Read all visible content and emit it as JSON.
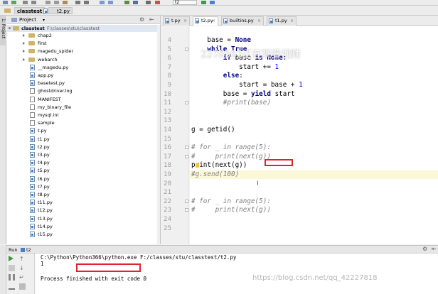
{
  "toolbar": {
    "config_select": "t2",
    "icons": [
      "save-icon",
      "sync-icon",
      "undo-icon",
      "redo-icon",
      "cut-icon",
      "copy-icon",
      "paste-icon",
      "find-icon",
      "replace-icon",
      "back-icon",
      "forward-icon",
      "run-icon",
      "debug-icon",
      "stop-icon"
    ]
  },
  "breadcrumb": {
    "items": [
      "classtest",
      "t2.py"
    ]
  },
  "side_strip": {
    "project_tab": "1: Project"
  },
  "project_panel": {
    "title": "Project",
    "root_name": "classtest",
    "root_path": "F:\\classes\\stu\\classtest",
    "items": [
      {
        "label": "chap2",
        "type": "folder"
      },
      {
        "label": "first",
        "type": "folder"
      },
      {
        "label": "magedu_spider",
        "type": "folder"
      },
      {
        "label": "webarch",
        "type": "folder"
      },
      {
        "label": "__magedu.py",
        "type": "py"
      },
      {
        "label": "app.py",
        "type": "py"
      },
      {
        "label": "basetest.py",
        "type": "py"
      },
      {
        "label": "ghostdriver.log",
        "type": "txt"
      },
      {
        "label": "MANIFEST",
        "type": "txt"
      },
      {
        "label": "my_binary_file",
        "type": "txt"
      },
      {
        "label": "mysql.ini",
        "type": "txt"
      },
      {
        "label": "sample",
        "type": "txt"
      },
      {
        "label": "t.py",
        "type": "py"
      },
      {
        "label": "t1.py",
        "type": "py"
      },
      {
        "label": "t2.py",
        "type": "py"
      },
      {
        "label": "t3.py",
        "type": "py"
      },
      {
        "label": "t4.py",
        "type": "py"
      },
      {
        "label": "t5.py",
        "type": "py"
      },
      {
        "label": "t6.py",
        "type": "py"
      },
      {
        "label": "t7.py",
        "type": "py"
      },
      {
        "label": "t8.py",
        "type": "py"
      },
      {
        "label": "t11.py",
        "type": "py"
      },
      {
        "label": "t12.py",
        "type": "py"
      },
      {
        "label": "t13.py",
        "type": "py"
      },
      {
        "label": "t14.py",
        "type": "py"
      },
      {
        "label": "t15.py",
        "type": "py"
      }
    ]
  },
  "editor_tabs": [
    {
      "label": "t.py",
      "active": false
    },
    {
      "label": "t2.py",
      "active": true
    },
    {
      "label": "builtins.py",
      "active": false
    },
    {
      "label": "t1.py",
      "active": false
    }
  ],
  "editor": {
    "current_line": "19",
    "lines": [
      {
        "num": "4",
        "html": "    base = <span class=\"kw\">None</span>"
      },
      {
        "num": "5",
        "html": "    <span class=\"kw\">while True</span>"
      },
      {
        "num": "6",
        "html": "        <span class=\"kw\">if</span> base <span class=\"kw\">is None</span>:"
      },
      {
        "num": "7",
        "html": "            start += <span class=\"num\">1</span>"
      },
      {
        "num": "8",
        "html": "        <span class=\"kw\">else</span>:"
      },
      {
        "num": "9",
        "html": "            start = base + <span class=\"num\">1</span>"
      },
      {
        "num": "10",
        "html": "        base = <span class=\"kw\">yield</span> start"
      },
      {
        "num": "11",
        "html": "        <span class=\"cm\">#print(base)</span>"
      },
      {
        "num": "12",
        "html": ""
      },
      {
        "num": "13",
        "html": ""
      },
      {
        "num": "14",
        "html": "g = getid()"
      },
      {
        "num": "15",
        "html": ""
      },
      {
        "num": "16",
        "html": "<span class=\"cm\"># for _ in range(5):</span>"
      },
      {
        "num": "17",
        "html": "<span class=\"cm\">#     print(next(g))</span>"
      },
      {
        "num": "18",
        "html": "print(next(g))"
      },
      {
        "num": "19",
        "html": "<span class=\"cm\">#g.send(100)</span>"
      },
      {
        "num": "20",
        "html": ""
      },
      {
        "num": "21",
        "html": ""
      },
      {
        "num": "22",
        "html": "<span class=\"cm\"># for _ in range(5):</span>"
      },
      {
        "num": "23",
        "html": "<span class=\"cm\">#     print(next(g))</span>"
      },
      {
        "num": "24",
        "html": ""
      },
      {
        "num": "25",
        "html": ""
      }
    ],
    "overlay_watermark": "2278563正在观看视频"
  },
  "run_panel": {
    "title": "t2",
    "label": "Run",
    "lines": [
      "C:\\Python\\Python366\\python.exe F:/classes/stu/classtest/t2.py",
      "1",
      "",
      "Process finished with exit code 0"
    ],
    "watermark": "https://blog.csdn.net/qq_42227818"
  },
  "colors": {
    "annotation_red": "#e0222e",
    "current_line": "#fbf8d8",
    "keyword": "#000080",
    "number": "#0000ff",
    "comment": "#808080"
  }
}
